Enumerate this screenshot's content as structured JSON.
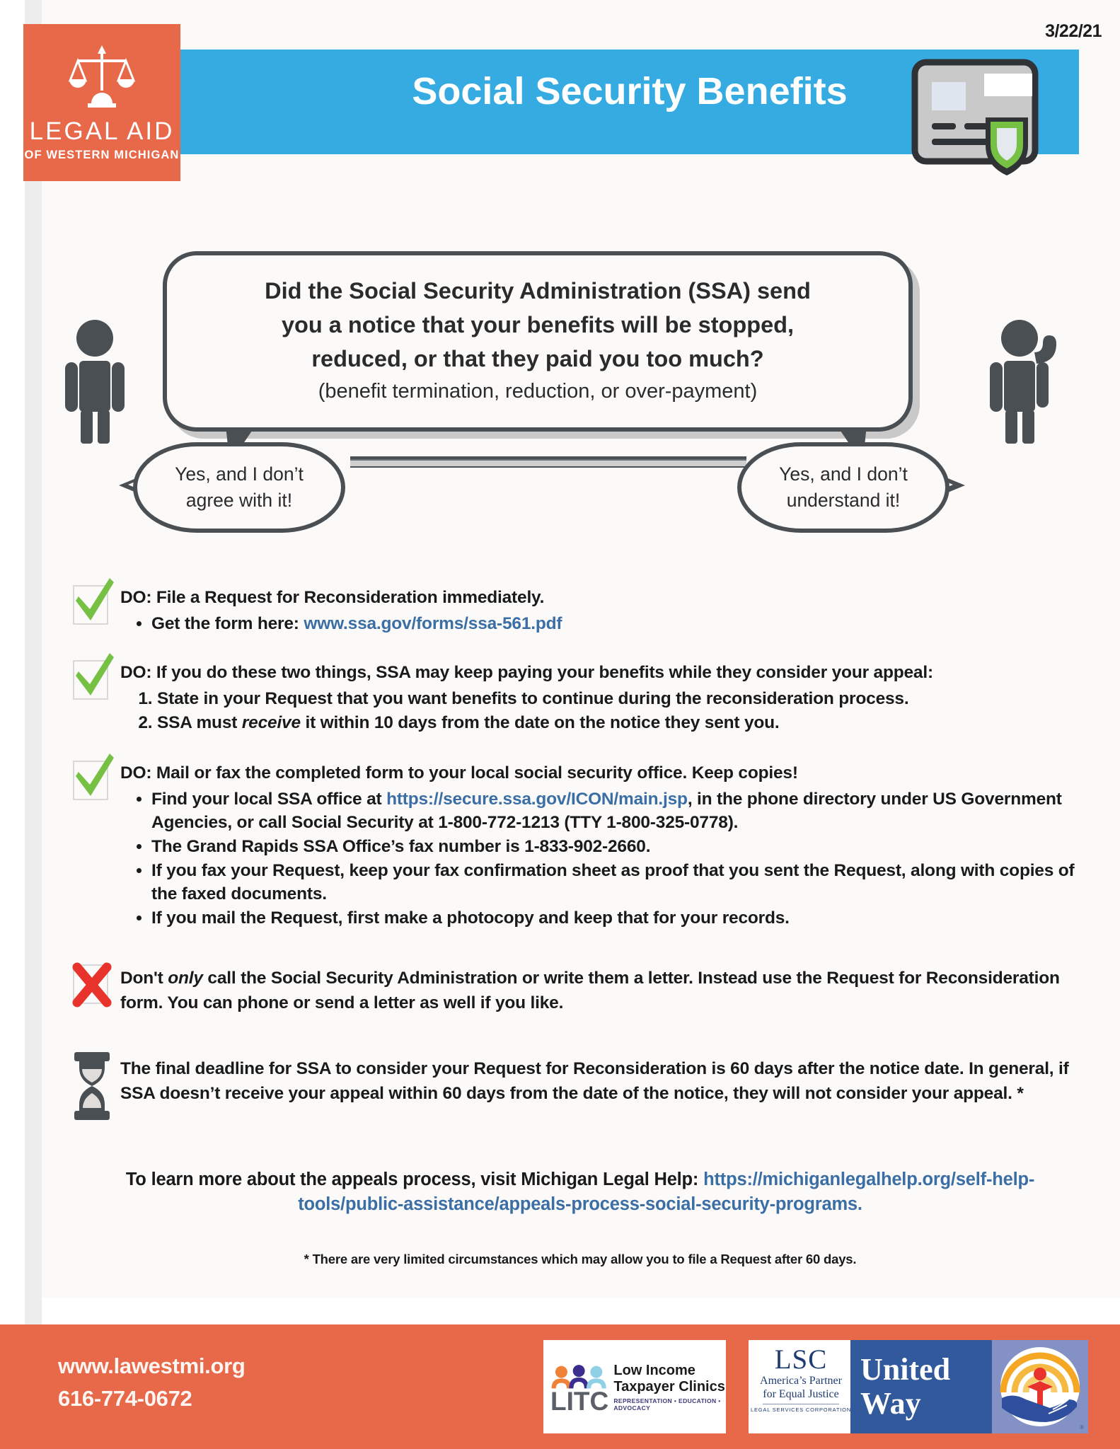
{
  "date_stamp": "3/22/21",
  "logo": {
    "title": "LEGAL AID",
    "subtitle": "OF WESTERN MICHIGAN",
    "icon": "scales-of-justice-icon"
  },
  "banner": {
    "title": "Social Security Benefits",
    "art_icon": "id-card-with-shield-icon",
    "color": "#35abe2"
  },
  "main_bubble": {
    "line1": "Did the Social Security Administration (SSA) send",
    "line2": "you a notice that your benefits will be stopped,",
    "line3": "reduced, or that they paid you too much?",
    "subtext": "(benefit termination, reduction, or over-payment)"
  },
  "left_bubble": {
    "line1": "Yes, and I don’t",
    "line2": "agree with it!"
  },
  "right_bubble": {
    "line1": "Yes, and I don’t",
    "line2": "understand it!"
  },
  "items": [
    {
      "mark": "green-check-icon",
      "lead_prefix": "DO: ",
      "lead": "File a Request for Reconsideration immediately.",
      "bullets": [
        {
          "text_before": "Get the form here: ",
          "link": "www.ssa.gov/forms/ssa-561.pdf",
          "text_after": ""
        }
      ]
    },
    {
      "mark": "green-check-icon",
      "lead_prefix": "DO: ",
      "lead": "If you do these two things, SSA may keep paying your benefits while they consider your appeal:",
      "numbered": [
        "State in your Request that you want benefits to continue during the reconsideration process.",
        "SSA must receive it within 10 days from the date on the notice they sent you."
      ]
    },
    {
      "mark": "green-check-icon",
      "lead_prefix": "DO: ",
      "lead": "Mail or fax the completed form to your local social security office. Keep copies!",
      "bullets": [
        {
          "text_before": "Find your local SSA office at ",
          "link": "https://secure.ssa.gov/ICON/main.jsp",
          "text_after": ", in the phone directory under US Government Agencies, or call Social Security at 1-800-772-1213 (TTY 1-800-325-0778)."
        },
        {
          "text_before": "The Grand Rapids SSA Office’s fax number is 1-833-902-2660.",
          "link": "",
          "text_after": ""
        },
        {
          "text_before": "If you fax your Request, keep your fax confirmation sheet as proof that you sent the Request, along with copies of the faxed documents.",
          "link": "",
          "text_after": ""
        },
        {
          "text_before": "If you mail the Request, first make a photocopy and keep that for your records.",
          "link": "",
          "text_after": ""
        }
      ]
    }
  ],
  "dont_item": {
    "mark": "red-x-icon",
    "part1": "Don't ",
    "emphasis": "only",
    "part2": " call the Social Security Administration or write them a letter. Instead use the Request for Reconsideration form. You can phone or send a letter as well if you like."
  },
  "deadline_item": {
    "mark": "hourglass-icon",
    "text": "The final deadline for SSA to consider your Request for Reconsideration is 60 days after the notice date. In general, if SSA doesn’t receive your appeal within 60 days from the date of the notice, they will not consider your appeal. *"
  },
  "learn_more": {
    "text_before": "To learn more about the appeals process, visit Michigan Legal Help: ",
    "link": "https://michiganlegalhelp.org/self-help-tools/public-assistance/appeals-process-social-security-programs."
  },
  "footnote": "*  There are very limited circumstances which may allow you to file a Request after 60 days.",
  "footer": {
    "website": "www.lawestmi.org",
    "phone": "616-774-0672",
    "background": "#e8684a",
    "logos": {
      "litc": {
        "acronym": "LITC",
        "line1": "Low Income",
        "line2": "Taxpayer Clinics",
        "line3": "REPRESENTATION  •  EDUCATION  •  ADVOCACY"
      },
      "lsc": {
        "acronym": "LSC",
        "line1": "America’s Partner",
        "line2": "for Equal Justice",
        "line3": "LEGAL SERVICES CORPORATION"
      },
      "united_way": {
        "line1": "United",
        "line2": "Way",
        "registered": "®"
      }
    }
  },
  "colors": {
    "orange": "#e8684a",
    "blue": "#35abe2",
    "green_check": "#76c043",
    "red_x": "#e8322c",
    "link_blue": "#3a6ea5",
    "dark_gray": "#4a4f54"
  }
}
